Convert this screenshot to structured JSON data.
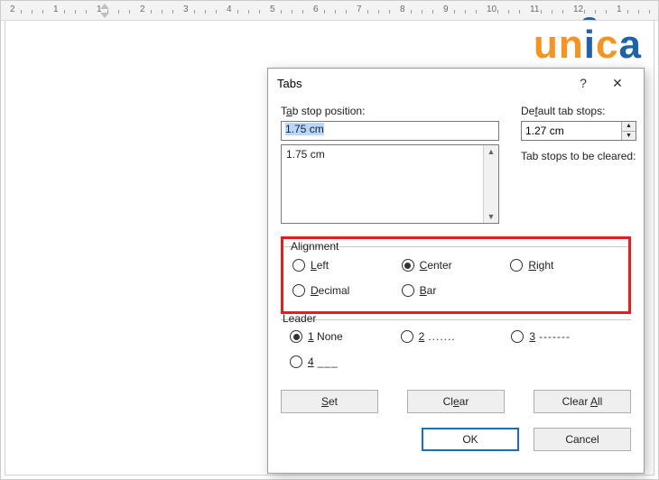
{
  "ruler": {
    "nums": [
      "2",
      "1",
      "1",
      "2",
      "3",
      "4",
      "5",
      "6",
      "7",
      "8",
      "9",
      "10",
      "11",
      "12",
      "1"
    ]
  },
  "logo": {
    "text": "unica"
  },
  "dialog": {
    "title": "Tabs",
    "help": "?",
    "close": "✕",
    "tab_stop_label_pre": "T",
    "tab_stop_label_u": "a",
    "tab_stop_label_post": "b stop position:",
    "tab_stop_value": "1.75 cm",
    "list_items": [
      "1.75 cm"
    ],
    "default_label_pre": "De",
    "default_label_u": "f",
    "default_label_post": "ault tab stops:",
    "default_value": "1.27 cm",
    "cleared_note": "Tab stops to be cleared:",
    "alignment": {
      "legend": "Alignment",
      "left_u": "L",
      "left": "eft",
      "center_u": "C",
      "center": "enter",
      "right_u": "R",
      "right": "ight",
      "decimal_u": "D",
      "decimal": "ecimal",
      "bar_u": "B",
      "bar": "ar",
      "selected": "center"
    },
    "leader": {
      "legend": "Leader",
      "opt1_u": "1",
      "opt1": " None",
      "opt2_u": "2",
      "opt2_sample": ".......",
      "opt3_u": "3",
      "opt3_sample": "-------",
      "opt4_u": "4",
      "opt4_sample": "___",
      "selected": "1"
    },
    "buttons": {
      "set_u": "S",
      "set": "et",
      "clear_pre": "Cl",
      "clear_u": "e",
      "clear_post": "ar",
      "clearall_pre": "Clear ",
      "clearall_u": "A",
      "clearall_post": "ll",
      "ok": "OK",
      "cancel": "Cancel"
    }
  }
}
